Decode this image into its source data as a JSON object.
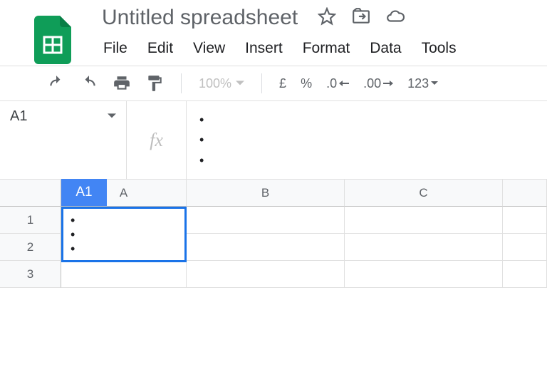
{
  "doc": {
    "title": "Untitled spreadsheet"
  },
  "menu": {
    "file": "File",
    "edit": "Edit",
    "view": "View",
    "insert": "Insert",
    "format": "Format",
    "data": "Data",
    "tools": "Tools"
  },
  "toolbar": {
    "zoom": "100%",
    "currency": "£",
    "percent": "%",
    "dec_less": ".0",
    "dec_more": ".00",
    "more_fmt": "123"
  },
  "namebox": {
    "value": "A1"
  },
  "formula": {
    "fx": "fx",
    "b1": "•",
    "b2": "•",
    "b3": "•"
  },
  "columns": {
    "a": "A",
    "b": "B",
    "c": "C"
  },
  "rows": {
    "r1": "1",
    "r2": "2",
    "r3": "3"
  },
  "active": {
    "label": "A1",
    "b1": "•",
    "b2": "•",
    "b3": "•"
  }
}
